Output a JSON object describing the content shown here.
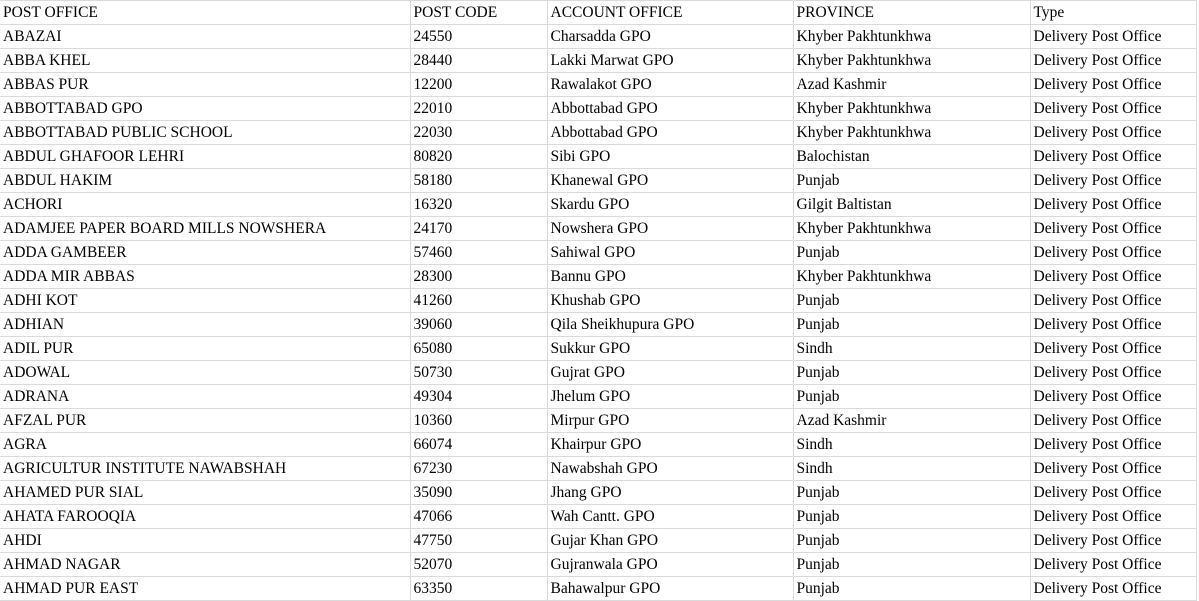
{
  "columns": [
    "POST OFFICE",
    "POST CODE",
    "ACCOUNT OFFICE",
    "PROVINCE",
    "Type"
  ],
  "rows": [
    [
      "ABAZAI",
      "24550",
      "Charsadda GPO",
      "Khyber Pakhtunkhwa",
      "Delivery Post Office"
    ],
    [
      "ABBA KHEL",
      "28440",
      "Lakki Marwat GPO",
      "Khyber Pakhtunkhwa",
      "Delivery Post Office"
    ],
    [
      "ABBAS PUR",
      "12200",
      "Rawalakot GPO",
      "Azad Kashmir",
      "Delivery Post Office"
    ],
    [
      "ABBOTTABAD GPO",
      "22010",
      "Abbottabad GPO",
      "Khyber Pakhtunkhwa",
      "Delivery Post Office"
    ],
    [
      "ABBOTTABAD PUBLIC SCHOOL",
      "22030",
      "Abbottabad GPO",
      "Khyber Pakhtunkhwa",
      "Delivery Post Office"
    ],
    [
      "ABDUL GHAFOOR LEHRI",
      "80820",
      "Sibi GPO",
      "Balochistan",
      "Delivery Post Office"
    ],
    [
      "ABDUL HAKIM",
      "58180",
      "Khanewal GPO",
      "Punjab",
      "Delivery Post Office"
    ],
    [
      "ACHORI",
      "16320",
      "Skardu GPO",
      "Gilgit Baltistan",
      "Delivery Post Office"
    ],
    [
      "ADAMJEE PAPER BOARD MILLS NOWSHERA",
      "24170",
      "Nowshera GPO",
      "Khyber Pakhtunkhwa",
      "Delivery Post Office"
    ],
    [
      "ADDA GAMBEER",
      "57460",
      "Sahiwal GPO",
      "Punjab",
      "Delivery Post Office"
    ],
    [
      "ADDA MIR ABBAS",
      "28300",
      "Bannu GPO",
      "Khyber Pakhtunkhwa",
      "Delivery Post Office"
    ],
    [
      "ADHI KOT",
      "41260",
      "Khushab GPO",
      "Punjab",
      "Delivery Post Office"
    ],
    [
      "ADHIAN",
      "39060",
      "Qila Sheikhupura GPO",
      "Punjab",
      "Delivery Post Office"
    ],
    [
      "ADIL PUR",
      "65080",
      "Sukkur GPO",
      "Sindh",
      "Delivery Post Office"
    ],
    [
      "ADOWAL",
      "50730",
      "Gujrat GPO",
      "Punjab",
      "Delivery Post Office"
    ],
    [
      "ADRANA",
      "49304",
      "Jhelum GPO",
      "Punjab",
      "Delivery Post Office"
    ],
    [
      "AFZAL PUR",
      "10360",
      "Mirpur GPO",
      "Azad Kashmir",
      "Delivery Post Office"
    ],
    [
      "AGRA",
      "66074",
      "Khairpur GPO",
      "Sindh",
      "Delivery Post Office"
    ],
    [
      "AGRICULTUR INSTITUTE NAWABSHAH",
      "67230",
      "Nawabshah GPO",
      "Sindh",
      "Delivery Post Office"
    ],
    [
      "AHAMED PUR SIAL",
      "35090",
      "Jhang GPO",
      "Punjab",
      "Delivery Post Office"
    ],
    [
      "AHATA FAROOQIA",
      "47066",
      "Wah Cantt. GPO",
      "Punjab",
      "Delivery Post Office"
    ],
    [
      "AHDI",
      "47750",
      "Gujar Khan GPO",
      "Punjab",
      "Delivery Post Office"
    ],
    [
      "AHMAD NAGAR",
      "52070",
      "Gujranwala GPO",
      "Punjab",
      "Delivery Post Office"
    ],
    [
      "AHMAD PUR EAST",
      "63350",
      "Bahawalpur GPO",
      "Punjab",
      "Delivery Post Office"
    ]
  ]
}
